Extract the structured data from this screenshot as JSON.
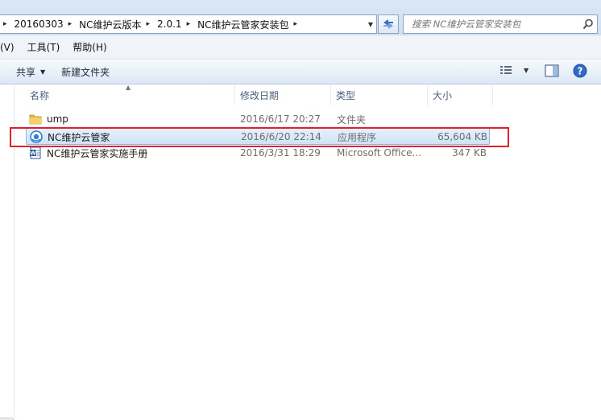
{
  "address_bar": {
    "breadcrumbs": [
      "20160303",
      "NC维护云版本",
      "2.0.1",
      "NC维护云管家安装包"
    ],
    "separator": "▸"
  },
  "search": {
    "placeholder": "搜索 NC维护云管家安装包"
  },
  "menu": {
    "items": [
      {
        "label": "(V)"
      },
      {
        "label": "工具(T)"
      },
      {
        "label": "帮助(H)"
      }
    ]
  },
  "toolbar": {
    "share_label": "共享",
    "new_folder_label": "新建文件夹"
  },
  "columns": {
    "name": "名称",
    "date": "修改日期",
    "type": "类型",
    "size": "大小"
  },
  "files": [
    {
      "name": "ump",
      "date": "2016/6/17 20:27",
      "type": "文件夹",
      "size": "",
      "icon": "folder-icon",
      "selected": false
    },
    {
      "name": "NC维护云管家",
      "date": "2016/6/20 22:14",
      "type": "应用程序",
      "size": "65,604 KB",
      "icon": "application-icon",
      "selected": true
    },
    {
      "name": "NC维护云管家实施手册",
      "date": "2016/3/31 18:29",
      "type": "Microsoft Office...",
      "size": "347 KB",
      "icon": "word-document-icon",
      "selected": false
    }
  ],
  "colors": {
    "highlight_box": "#e0202a",
    "selection": "#cfe3f7",
    "chrome": "#dbe7f5"
  }
}
